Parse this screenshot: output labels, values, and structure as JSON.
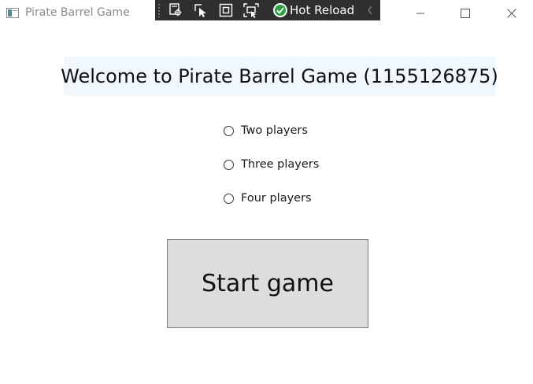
{
  "window": {
    "title": "Pirate Barrel Game",
    "controls": {
      "minimize_icon": "minimize-icon",
      "maximize_icon": "maximize-icon",
      "close_icon": "close-icon"
    }
  },
  "debug_toolbar": {
    "tools": [
      "select-element-icon",
      "pointer-select-icon",
      "layout-adorner-icon",
      "track-focus-icon"
    ],
    "hot_reload_label": "Hot Reload",
    "hot_reload_status_icon": "check-circle-icon",
    "hot_reload_status_color": "#2ea043"
  },
  "main": {
    "welcome_text": "Welcome to Pirate Barrel Game (1155126875)",
    "player_options": [
      {
        "label": "Two players",
        "selected": false
      },
      {
        "label": "Three players",
        "selected": false
      },
      {
        "label": "Four players",
        "selected": false
      }
    ],
    "start_button_label": "Start game"
  },
  "colors": {
    "welcome_background": "#f0f7fd",
    "button_background": "#dddddd",
    "toolbar_background": "#2f2f2f"
  }
}
